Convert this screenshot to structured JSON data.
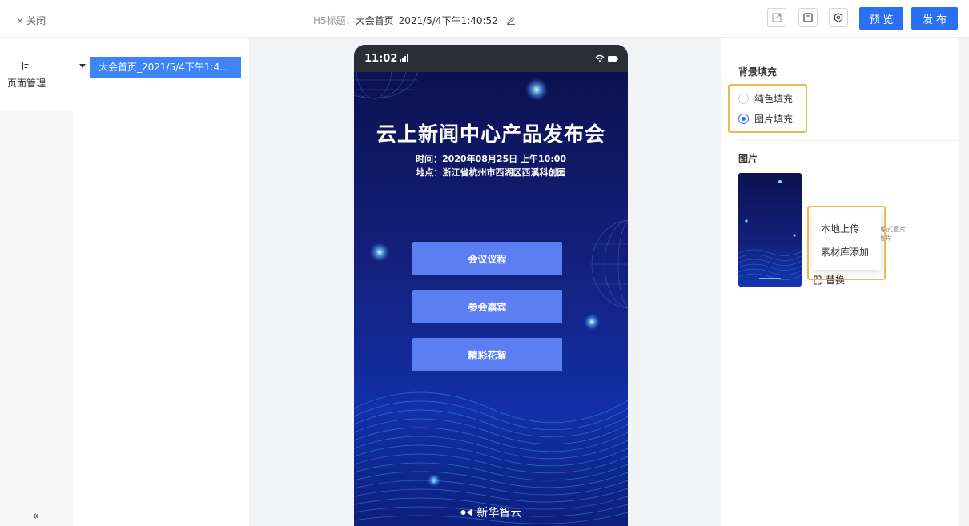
{
  "topbar": {
    "close_icon": "×",
    "close_label": "关闭",
    "title_label": "H5标题：",
    "title_value": "大会首页_2021/5/4下午1:40:52",
    "preview_label": "预览",
    "publish_label": "发布",
    "accent": "#2b6ff5",
    "icons": [
      "external-link-icon",
      "save-icon",
      "settings-icon"
    ]
  },
  "leftrail": {
    "page_manage_label": "页面管理",
    "collapse_glyph": "«"
  },
  "tree": {
    "node_label": "大会首页_2021/5/4下午1:4..."
  },
  "phone": {
    "time": "11:02",
    "title": "云上新闻中心产品发布会",
    "time_line": "时间：2020年08月25日 上午10:00",
    "place_line": "地点：浙江省杭州市西湖区西溪科创园",
    "buttons": [
      "会议议程",
      "参会嘉宾",
      "精彩花絮"
    ],
    "logo_text": "新华智云",
    "button_color": "#5b7ef0"
  },
  "rightpanel": {
    "bg_fill_title": "背景填充",
    "solid_fill_label": "纯色填充",
    "image_fill_label": "图片填充",
    "selected_fill": "图片填充",
    "image_title": "图片",
    "desc_line1": "j格式图片",
    "desc_line2": "图片",
    "menu_local_upload": "本地上传",
    "menu_library_add": "素材库添加",
    "replace_label": "替换",
    "highlight_color": "#f0b84a"
  }
}
